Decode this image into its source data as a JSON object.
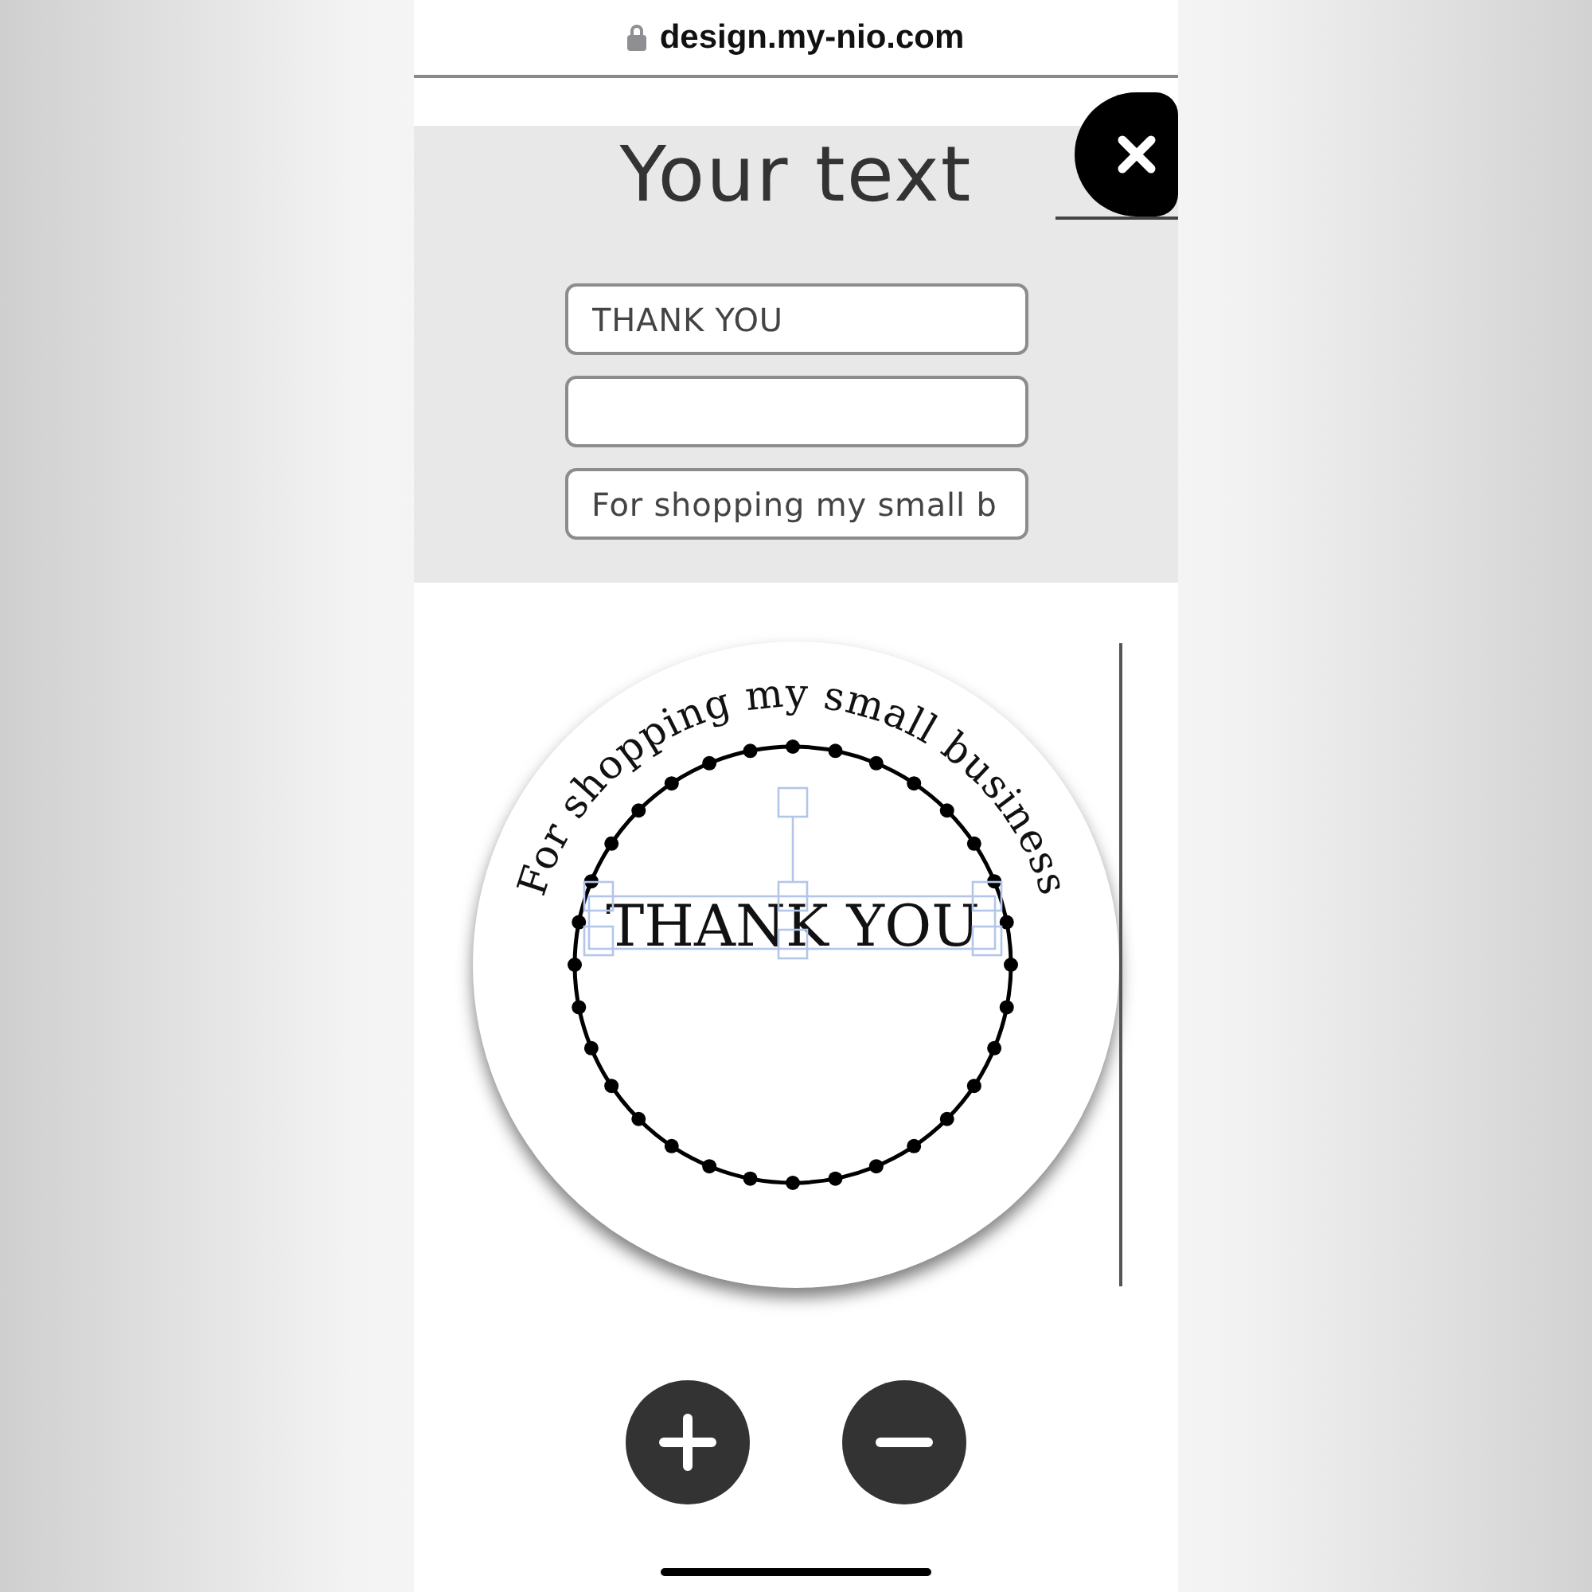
{
  "browser": {
    "url": "design.my-nio.com",
    "secure": true
  },
  "panel": {
    "title": "Your text",
    "top_field": {
      "value": "THANK YOU"
    },
    "bottom_field": {
      "value": "For shopping my small b"
    }
  },
  "design": {
    "curved_text": "For shopping my small business",
    "center_text": "THANK YOU",
    "selected": true
  }
}
